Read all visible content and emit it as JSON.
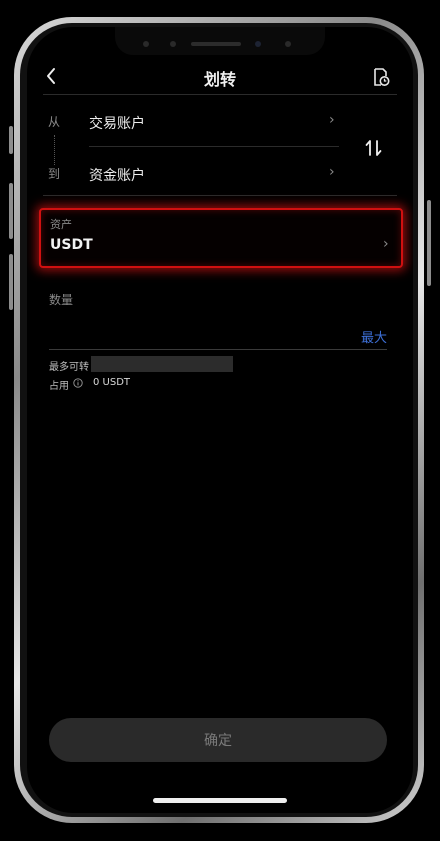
{
  "header": {
    "title": "划转",
    "back_icon": "chevron-left-icon",
    "history_icon": "document-clock-icon"
  },
  "transfer": {
    "from_label": "从",
    "to_label": "到",
    "from_account": "交易账户",
    "to_account": "资金账户",
    "swap_icon": "swap-arrows-icon"
  },
  "asset": {
    "label": "资产",
    "value": "USDT",
    "highlight_color": "#d01010"
  },
  "quantity": {
    "label": "数量",
    "value": "",
    "max_label": "最大",
    "max_color": "#3d6fd6"
  },
  "info": {
    "max_transferable_label": "最多可转",
    "occupied_label": "占用",
    "occupied_value": "0 USDT"
  },
  "confirm": {
    "label": "确定"
  }
}
